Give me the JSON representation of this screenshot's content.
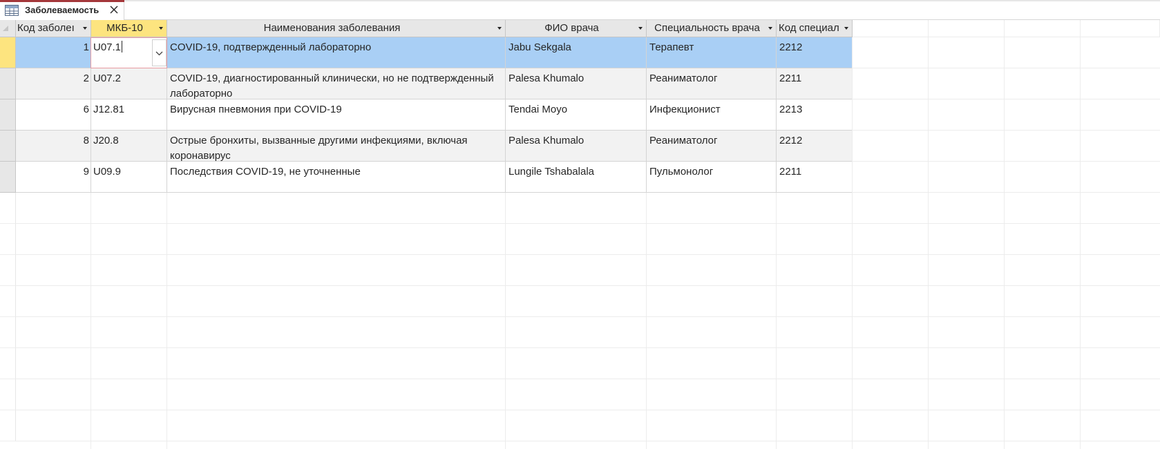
{
  "tab": {
    "label": "Заболеваемость",
    "icon": "table-icon",
    "close_icon": "close-icon",
    "accent_color": "#a4373a"
  },
  "columns": [
    {
      "key": "code",
      "label": "Код заболеı",
      "align": "right"
    },
    {
      "key": "mkb",
      "label": "МКБ-10",
      "align": "left",
      "selected": true
    },
    {
      "key": "name",
      "label": "Наименования заболевания",
      "align": "left"
    },
    {
      "key": "doctor",
      "label": "ФИО врача",
      "align": "left"
    },
    {
      "key": "specialty",
      "label": "Специальность врача",
      "align": "left"
    },
    {
      "key": "spec_code",
      "label": "Код специал",
      "align": "left"
    }
  ],
  "rows": [
    {
      "code": "1",
      "mkb": "U07.1",
      "name": "COVID-19, подтвержденный лабораторно",
      "doctor": "Jabu Sekgala",
      "specialty": "Терапевт",
      "spec_code": "2212"
    },
    {
      "code": "2",
      "mkb": "U07.2",
      "name": "COVID-19, диагностированный клинически, но не подтвержденный лабораторно",
      "doctor": "Palesa Khumalo",
      "specialty": "Реаниматолог",
      "spec_code": "2211"
    },
    {
      "code": "6",
      "mkb": "J12.81",
      "name": "Вирусная пневмония при COVID-19",
      "doctor": "Tendai Moyo",
      "specialty": "Инфекционист",
      "spec_code": "2213"
    },
    {
      "code": "8",
      "mkb": "J20.8",
      "name": "Острые бронхиты, вызванные другими инфекциями, включая коронавирус",
      "doctor": "Palesa Khumalo",
      "specialty": "Реаниматолог",
      "spec_code": "2212"
    },
    {
      "code": "9",
      "mkb": "U09.9",
      "name": "Последствия COVID-19, не уточненные",
      "doctor": "Lungile Tshabalala",
      "specialty": "Пульмонолог",
      "spec_code": "2211"
    }
  ],
  "active_row": 0,
  "editor": {
    "value": "U07.1",
    "dropdown_icon": "chevron-down-icon"
  },
  "colors": {
    "header_bg": "#e7e7e7",
    "selected_header_bg": "#fde47f",
    "active_row_bg": "#a9cff5",
    "alt_row_bg": "#f2f2f2"
  }
}
